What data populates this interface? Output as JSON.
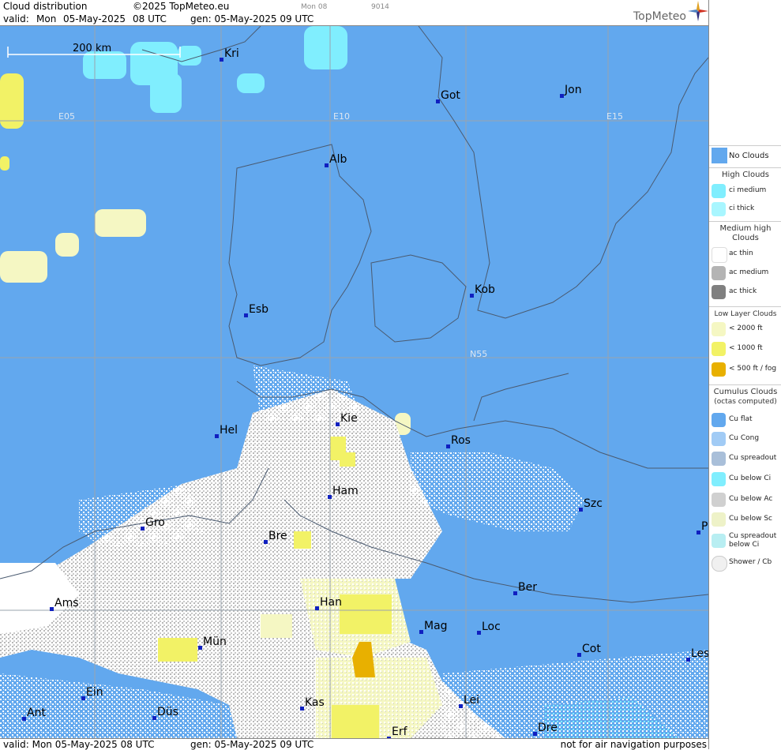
{
  "header": {
    "title": "Cloud distribution",
    "copyright": "©2025 TopMeteo.eu",
    "valid_label": "valid:",
    "valid_day": "Mon",
    "valid_date": "05-May-2025",
    "valid_time": "08 UTC",
    "gen": "gen: 05-May-2025 09 UTC",
    "tab_day": "Mon 08",
    "code": "9014",
    "logo": "TopMeteo"
  },
  "footer": {
    "valid": "valid:  Mon  05-May-2025  08 UTC",
    "gen": "gen: 05-May-2025 09 UTC",
    "disclaimer": "not for air navigation purposes"
  },
  "map": {
    "scale_label": "200 km",
    "grid_labels": [
      "E05",
      "E10",
      "E15",
      "N55"
    ],
    "colors": {
      "no_clouds": "#62a8ee",
      "ci_medium": "#80eefe",
      "low_2000": "#f5f7c3",
      "low_1000": "#f2f266",
      "fog": "#e8b000",
      "cu_grey": "#c8c8c8",
      "cu_white": "#ffffff",
      "city": "#1020c0"
    },
    "cities": [
      "Kri",
      "Got",
      "Jon",
      "Alb",
      "Kob",
      "Esb",
      "Kie",
      "Hel",
      "Ros",
      "Ham",
      "Szc",
      "Gro",
      "Bre",
      "Ber",
      "Ams",
      "Han",
      "Mag",
      "Loc",
      "Mün",
      "Cot",
      "Les",
      "Ein",
      "Kas",
      "Lei",
      "Ant",
      "Düs",
      "Dre",
      "Erf",
      "P"
    ]
  },
  "legend": {
    "no_clouds": "No Clouds",
    "high_clouds": "High Clouds",
    "ci_medium": "ci medium",
    "ci_thick": "ci thick",
    "medium_high_clouds": "Medium high Clouds",
    "ac_thin": "ac thin",
    "ac_medium": "ac medium",
    "ac_thick": "ac thick",
    "low_layer_clouds": "Low Layer Clouds",
    "low_2000": "< 2000 ft",
    "low_1000": "< 1000 ft",
    "low_500": "< 500 ft / fog",
    "cumulus_clouds": "Cumulus Clouds",
    "octas": "(octas computed)",
    "cu_flat": "Cu flat",
    "cu_cong": "Cu Cong",
    "cu_spreadout": "Cu spreadout",
    "cu_below_ci": "Cu below Ci",
    "cu_below_ac": "Cu below Ac",
    "cu_below_sc": "Cu below Sc",
    "cu_spreadout_below_ci": "Cu spreadout below Ci",
    "shower_cb": "Shower / Cb"
  }
}
